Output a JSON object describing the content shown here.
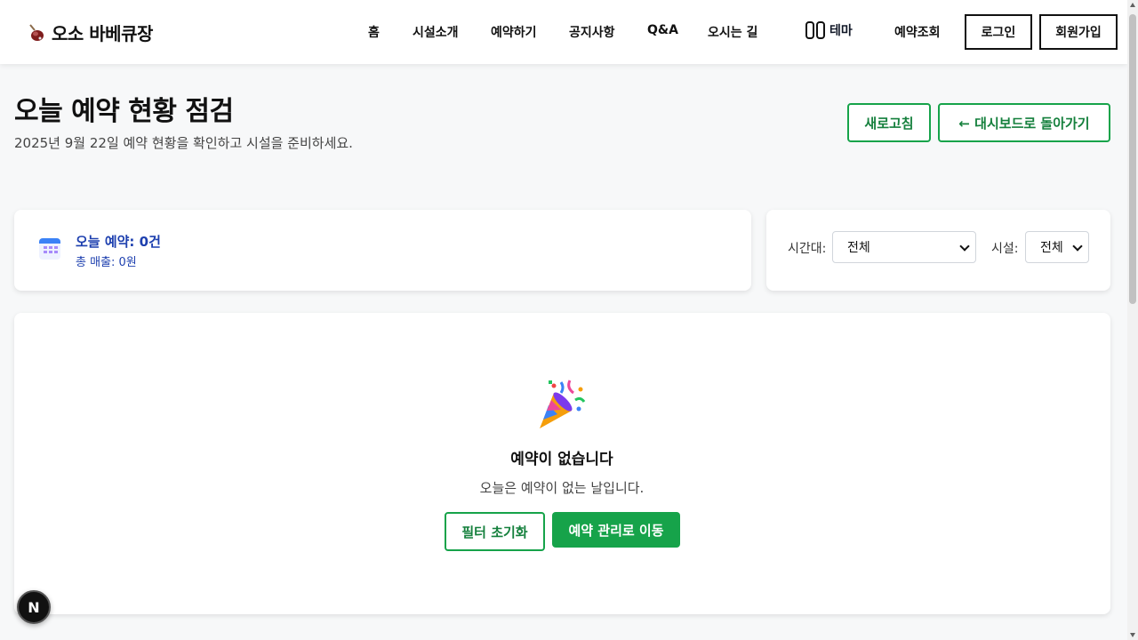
{
  "header": {
    "brand_title": "오소 바베큐장",
    "brand_icon": "meat-icon",
    "nav": [
      "홈",
      "시설소개",
      "예약하기",
      "공지사항",
      "Q&A",
      "오시는 길"
    ],
    "theme_label": "테마",
    "reservation_lookup": "예약조회",
    "login": "로그인",
    "signup": "회원가입"
  },
  "page": {
    "title": "오늘 예약 현황 점검",
    "subtitle": "2025년 9월 22일 예약 현황을 확인하고 시설을 준비하세요.",
    "refresh_button": "새로고침",
    "back_button": "← 대시보드로 돌아가기"
  },
  "summary": {
    "icon": "calendar-icon",
    "today_reservations": "오늘 예약: 0건",
    "total_sales": "총 매출: 0원"
  },
  "filters": {
    "time_label": "시간대:",
    "time_value": "전체",
    "facility_label": "시설:",
    "facility_value": "전체"
  },
  "empty_state": {
    "icon": "party-popper-icon",
    "title": "예약이 없습니다",
    "description": "오늘은 예약이 없는 날입니다.",
    "reset_button": "필터 초기화",
    "manage_button": "예약 관리로 이동"
  },
  "badge": {
    "label": "N"
  },
  "colors": {
    "accent": "#16a34a",
    "summary_text": "#1e40af"
  }
}
